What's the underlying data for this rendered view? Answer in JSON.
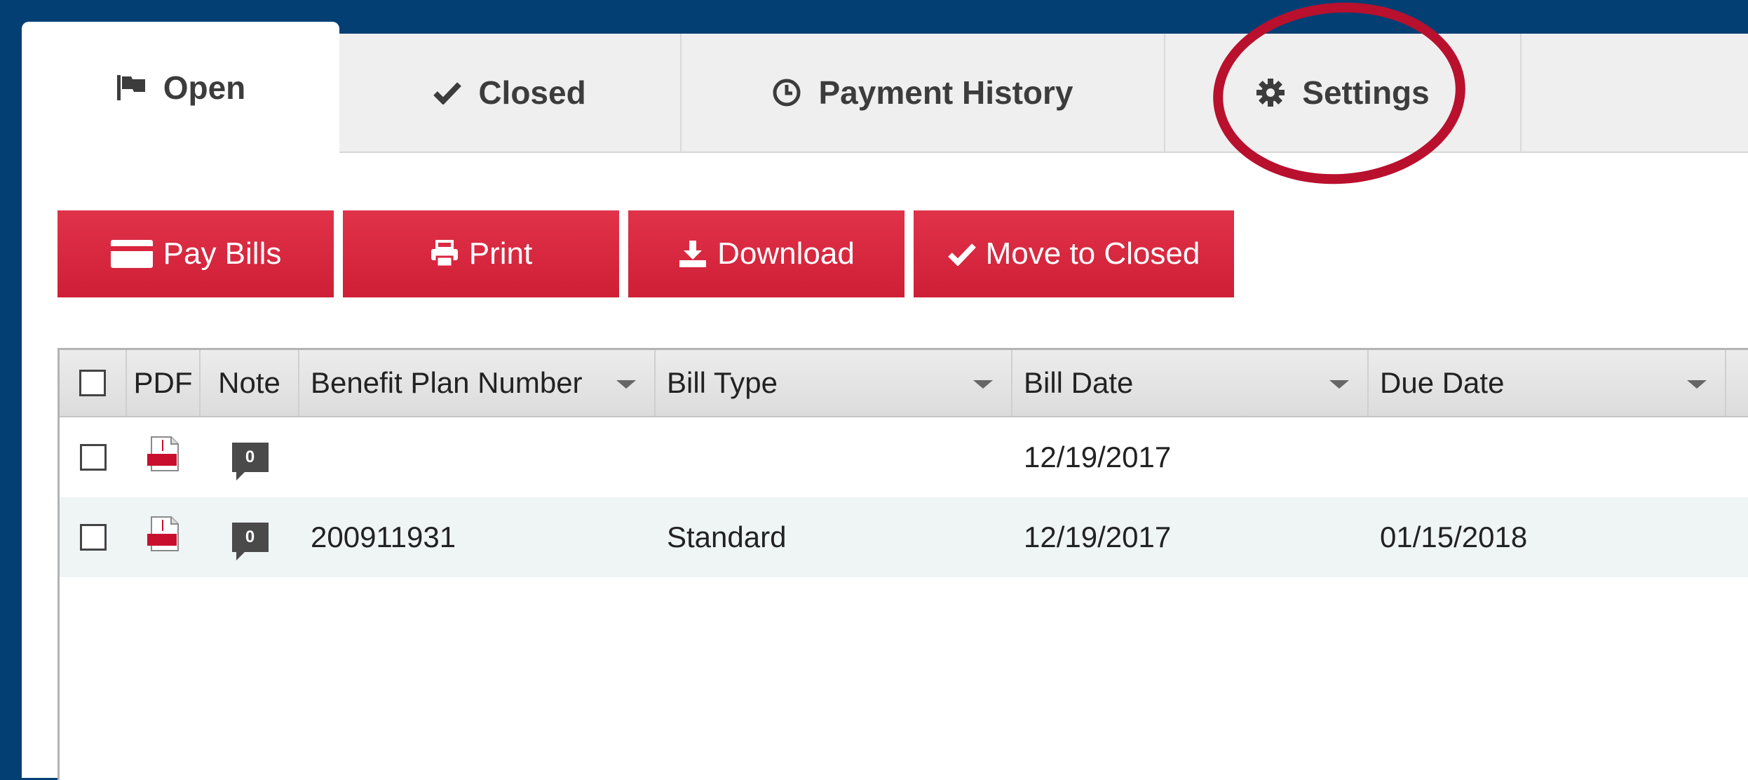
{
  "tabs": [
    {
      "label": "Open",
      "icon": "flag-icon",
      "active": true
    },
    {
      "label": "Closed",
      "icon": "checkmark-icon",
      "active": false
    },
    {
      "label": "Payment History",
      "icon": "clock-icon",
      "active": false
    },
    {
      "label": "Settings",
      "icon": "gear-icon",
      "active": false
    }
  ],
  "toolbar": {
    "pay_bills": "Pay Bills",
    "print": "Print",
    "download": "Download",
    "move_to_closed": "Move to Closed"
  },
  "grid": {
    "columns": {
      "pdf": "PDF",
      "note": "Note",
      "benefit_plan_number": "Benefit Plan Number",
      "bill_type": "Bill Type",
      "bill_date": "Bill Date",
      "due_date": "Due Date"
    },
    "rows": [
      {
        "note_count": "0",
        "benefit_plan_number": "",
        "bill_type": "",
        "bill_date": "12/19/2017",
        "due_date": ""
      },
      {
        "note_count": "0",
        "benefit_plan_number": "200911931",
        "bill_type": "Standard",
        "bill_date": "12/19/2017",
        "due_date": "01/15/2018"
      }
    ]
  },
  "colors": {
    "frame": "#043f74",
    "button": "#d9243d",
    "annotation": "#b9102e",
    "row_alt": "#eff4f5"
  }
}
